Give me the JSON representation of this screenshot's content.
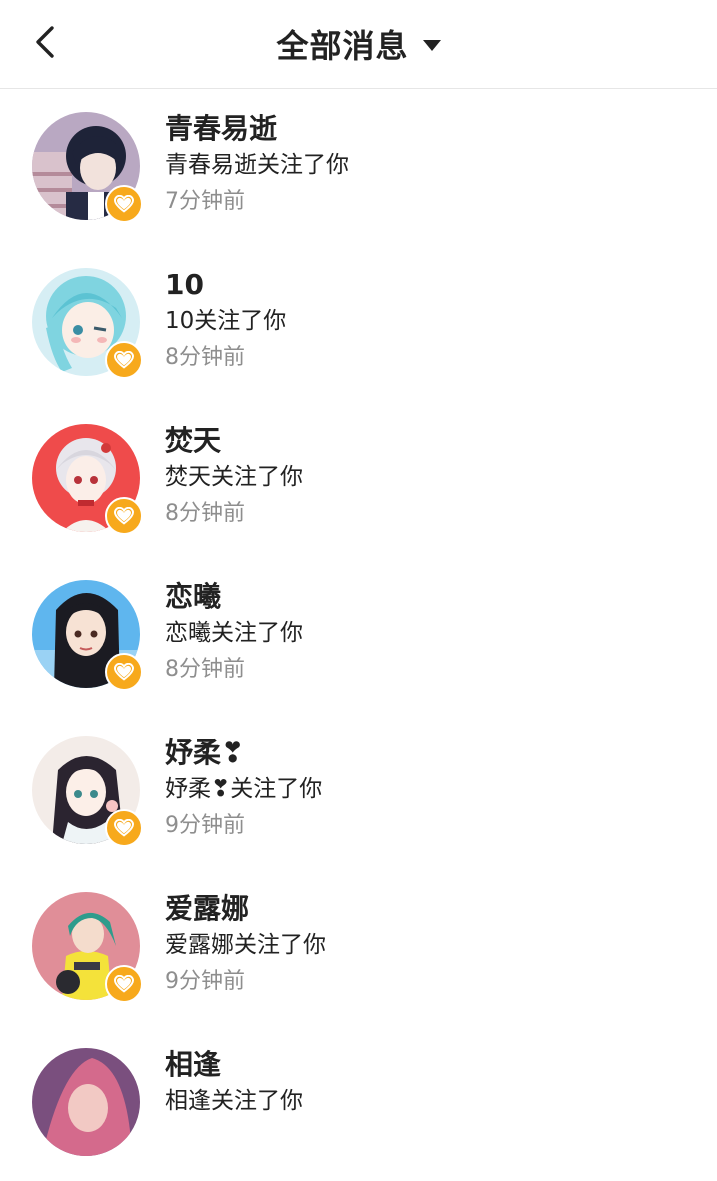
{
  "header": {
    "title": "全部消息",
    "back_icon": "chevron-left-icon",
    "dropdown_icon": "caret-down-icon"
  },
  "colors": {
    "badge": "#f7a91c",
    "secondary_text": "#8e8e8e",
    "divider": "#e6e6e6"
  },
  "notifications": [
    {
      "name": "青春易逝",
      "action": "青春易逝关注了你",
      "time": "7分钟前",
      "badge_icon": "heart-icon"
    },
    {
      "name": "10",
      "action": "10关注了你",
      "time": "8分钟前",
      "badge_icon": "heart-icon"
    },
    {
      "name": "焚天",
      "action": "焚天关注了你",
      "time": "8分钟前",
      "badge_icon": "heart-icon"
    },
    {
      "name": "恋曦",
      "action": "恋曦关注了你",
      "time": "8分钟前",
      "badge_icon": "heart-icon"
    },
    {
      "name": "妤柔❣",
      "action": "妤柔❣关注了你",
      "time": "9分钟前",
      "badge_icon": "heart-icon"
    },
    {
      "name": "爱露娜",
      "action": "爱露娜关注了你",
      "time": "9分钟前",
      "badge_icon": "heart-icon"
    },
    {
      "name": "相逢",
      "action": "相逢关注了你",
      "time": "",
      "badge_icon": "heart-icon"
    }
  ]
}
